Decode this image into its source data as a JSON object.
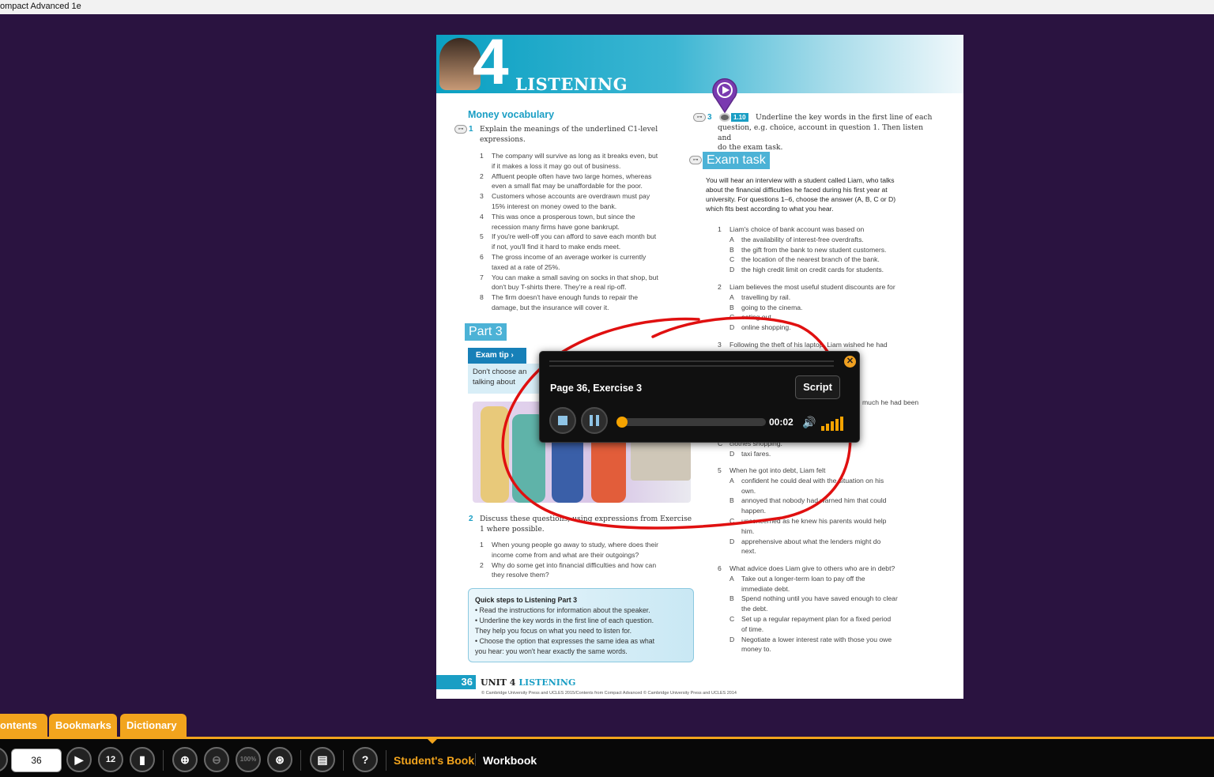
{
  "window": {
    "title": "ompact Advanced 1e"
  },
  "page": {
    "unit_number": "4",
    "unit_title": "LISTENING",
    "sec_money": "Money vocabulary",
    "q1_num": "1",
    "q1_text_a": "Explain the meanings of the underlined C1-level",
    "q1_text_b": "expressions.",
    "vocab": [
      {
        "n": "1",
        "l1": "The company will survive as long as it breaks even, but",
        "l2": "if it makes a loss it may go out of business."
      },
      {
        "n": "2",
        "l1": "Affluent people often have two large homes, whereas",
        "l2": "even a small flat may be unaffordable for the poor."
      },
      {
        "n": "3",
        "l1": "Customers whose accounts are overdrawn must pay",
        "l2": "15% interest on money owed to the bank."
      },
      {
        "n": "4",
        "l1": "This was once a prosperous town, but since the",
        "l2": "recession many firms have gone bankrupt."
      },
      {
        "n": "5",
        "l1": "If you're well-off you can afford to save each month but",
        "l2": "if not, you'll find it hard to make ends meet."
      },
      {
        "n": "6",
        "l1": "The gross income of an average worker is currently",
        "l2": "taxed at a rate of 25%."
      },
      {
        "n": "7",
        "l1": "You can make a small saving on socks in that shop, but",
        "l2": "don't buy T-shirts there. They're a real rip-off."
      },
      {
        "n": "8",
        "l1": "The firm doesn't have enough funds to repair the",
        "l2": "damage, but the insurance will cover it."
      }
    ],
    "part3": "Part 3",
    "exam_tip": "Exam tip",
    "tip_l1": "Don't choose an",
    "tip_l2": "talking about",
    "q2_num": "2",
    "q2_text_a": "Discuss these questions, using expressions from Exercise",
    "q2_text_b": "1 where possible.",
    "q2_items": [
      {
        "n": "1",
        "l1": "When young people go away to study, where does their",
        "l2": "income come from and what are their outgoings?"
      },
      {
        "n": "2",
        "l1": "Why do some get into financial difficulties and how can",
        "l2": "they resolve them?"
      }
    ],
    "quick_title": "Quick steps to Listening Part 3",
    "quick_lines": [
      "• Read the instructions for information about the speaker.",
      "• Underline the key words in the first line of each question.",
      "  They help you focus on what you need to listen for.",
      "• Choose the option that expresses the same idea as what",
      "  you hear: you won't hear exactly the same words."
    ],
    "q3_num": "3",
    "q3_track": "1.10",
    "q3_l1": "Underline the key words in the first line of each",
    "q3_l2": "question, e.g. choice, account in question 1. Then listen and",
    "q3_l3": "do the exam task.",
    "exam_task": "Exam task",
    "task_lines": [
      "You will hear an interview with a student called Liam, who talks",
      "about the financial difficulties he faced during his first year at",
      "university. For questions 1–6, choose the answer (A, B, C or D)",
      "which fits best according to what you hear."
    ],
    "task_q1": [
      "1",
      "Liam's choice of bank account was based on",
      "A",
      "the availability of interest-free overdrafts.",
      "B",
      "the gift from the bank to new student customers.",
      "C",
      "the location of the nearest branch of the bank.",
      "D",
      "the high credit limit on credit cards for students."
    ],
    "task_q2": [
      "2",
      "Liam believes the most useful student discounts are for",
      "A",
      "travelling by rail.",
      "B",
      "going to the cinema.",
      "C",
      "eating out.",
      "D",
      "online shopping."
    ],
    "task_q3": [
      "3",
      "Following the theft of his laptop, Liam wished he had",
      "",
      "uring the vacation.",
      "",
      "ance cover.",
      "",
      "vas more secure.",
      "",
      "ect his data."
    ],
    "task_q4_frag": "much he had been",
    "task_q4_end": [
      "C",
      "clothes shopping.",
      "D",
      "taxi fares."
    ],
    "task_q5": [
      "5",
      "When he got into debt, Liam felt",
      "A",
      "confident he could deal with the situation on his",
      "",
      "own.",
      "B",
      "annoyed that nobody had warned him that could",
      "",
      "happen.",
      "C",
      "unconcerned as he knew his parents would help",
      "",
      "him.",
      "D",
      "apprehensive about what the lenders might do",
      "",
      "next."
    ],
    "task_q6": [
      "6",
      "What advice does Liam give to others who are in debt?",
      "A",
      "Take out a longer-term loan to pay off the",
      "",
      "immediate debt.",
      "B",
      "Spend nothing until you have saved enough to clear",
      "",
      "the debt.",
      "C",
      "Set up a regular repayment plan for a fixed period",
      "",
      "of time.",
      "D",
      "Negotiate a lower interest rate with those you owe",
      "",
      "money to."
    ],
    "footer_page": "36",
    "footer_unit": "UNIT 4",
    "footer_listening": "LISTENING",
    "footer_copy": "© Cambridge University Press and UCLES 2015/Contents from Compact Advanced © Cambridge University Press and UCLES 2014"
  },
  "player": {
    "title": "Page 36, Exercise 3",
    "script_label": "Script",
    "time": "00:02",
    "progress": 0.0,
    "volume_level_bars": 5
  },
  "tabs": {
    "contents": "ontents",
    "bookmarks": "Bookmarks",
    "dictionary": "Dictionary"
  },
  "toolbar": {
    "page_value": "36",
    "zoom_label": "100%",
    "double_page": "12",
    "students_book": "Student's Book",
    "workbook": "Workbook"
  },
  "colors": {
    "accent": "#f2a41d",
    "teal": "#1a9ec4",
    "background": "#2a1340",
    "annotation": "#e01010"
  },
  "icons": [
    "play-icon",
    "double-page-icon",
    "bookmark-icon",
    "zoom-in-icon",
    "zoom-out-icon",
    "zoom-fit-icon",
    "toolkit-icon",
    "help-icon",
    "stop-icon",
    "pause-icon",
    "volume-icon",
    "close-icon",
    "audio-pin-icon",
    "key-icon"
  ]
}
